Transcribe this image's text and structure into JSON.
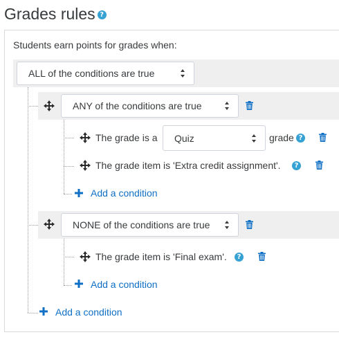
{
  "header": {
    "title": "Grades rules",
    "help_icon": "question-circle-icon"
  },
  "intro_text": "Students earn points for grades when:",
  "root_group": {
    "operator_selected": "ALL of the conditions are true"
  },
  "group_any": {
    "operator_selected": "ANY of the conditions are true",
    "rule_grade_type": {
      "prefix": "The grade is a",
      "select_value": "Quiz",
      "suffix": "grade"
    },
    "rule_grade_item": {
      "text": "The grade item is 'Extra credit assignment'."
    },
    "add_condition_label": "Add a condition"
  },
  "group_none": {
    "operator_selected": "NONE of the conditions are true",
    "rule_grade_item": {
      "text": "The grade item is 'Final exam'."
    },
    "add_condition_label": "Add a condition"
  },
  "root_add_condition_label": "Add a condition",
  "icons": {
    "move": "move-arrows-icon",
    "delete": "trash-icon",
    "add": "plus-icon",
    "help": "question-circle-icon"
  },
  "colors": {
    "link": "#0f6fc5",
    "help": "#36a1d3",
    "group_bg": "#efefef",
    "text": "#373a3c"
  }
}
